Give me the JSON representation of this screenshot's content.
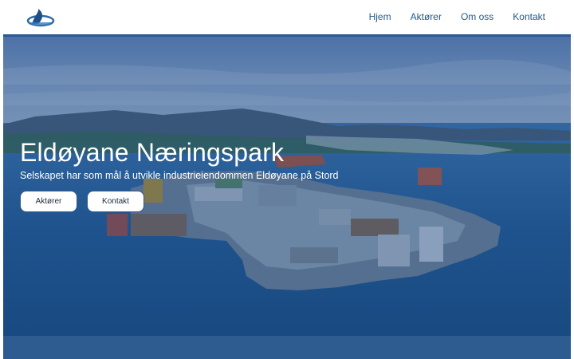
{
  "header": {
    "logo_icon": "eldoyane-logo-icon",
    "nav": [
      {
        "label": "Hjem"
      },
      {
        "label": "Aktører"
      },
      {
        "label": "Om oss"
      },
      {
        "label": "Kontakt"
      }
    ]
  },
  "hero": {
    "title": "Eldøyane Næringspark",
    "subtitle": "Selskapet har som mål å utvikle industrieiendommen Eldøyane på Stord",
    "buttons": [
      {
        "label": "Aktører"
      },
      {
        "label": "Kontakt"
      }
    ]
  },
  "colors": {
    "nav_text": "#1f5a8a",
    "accent_bar": "#2e5c91",
    "overlay": "#1e4a80"
  }
}
